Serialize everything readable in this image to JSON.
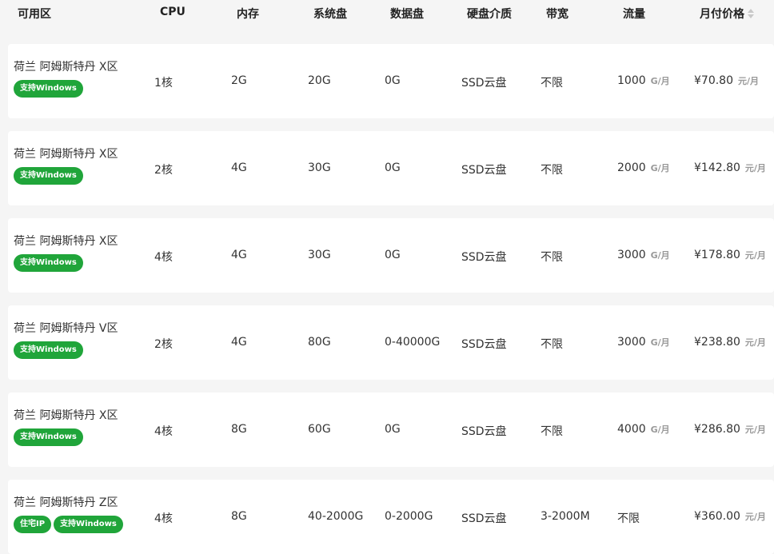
{
  "header": {
    "zone": "可用区",
    "cpu": "CPU",
    "memory": "内存",
    "system_disk": "系统盘",
    "data_disk": "数据盘",
    "disk_media": "硬盘介质",
    "bandwidth": "带宽",
    "traffic": "流量",
    "price": "月付价格"
  },
  "rows": [
    {
      "zone": "荷兰 阿姆斯特丹 X区",
      "tags": [
        "支持Windows"
      ],
      "cpu": "1核",
      "memory": "2G",
      "system_disk": "20G",
      "data_disk": "0G",
      "media": "SSD云盘",
      "bandwidth": "不限",
      "traffic": "1000",
      "traffic_unit": "G/月",
      "price": "¥70.80",
      "price_unit": "元/月"
    },
    {
      "zone": "荷兰 阿姆斯特丹 X区",
      "tags": [
        "支持Windows"
      ],
      "cpu": "2核",
      "memory": "4G",
      "system_disk": "30G",
      "data_disk": "0G",
      "media": "SSD云盘",
      "bandwidth": "不限",
      "traffic": "2000",
      "traffic_unit": "G/月",
      "price": "¥142.80",
      "price_unit": "元/月"
    },
    {
      "zone": "荷兰 阿姆斯特丹 X区",
      "tags": [
        "支持Windows"
      ],
      "cpu": "4核",
      "memory": "4G",
      "system_disk": "30G",
      "data_disk": "0G",
      "media": "SSD云盘",
      "bandwidth": "不限",
      "traffic": "3000",
      "traffic_unit": "G/月",
      "price": "¥178.80",
      "price_unit": "元/月"
    },
    {
      "zone": "荷兰 阿姆斯特丹 V区",
      "tags": [
        "支持Windows"
      ],
      "cpu": "2核",
      "memory": "4G",
      "system_disk": "80G",
      "data_disk": "0-40000G",
      "media": "SSD云盘",
      "bandwidth": "不限",
      "traffic": "3000",
      "traffic_unit": "G/月",
      "price": "¥238.80",
      "price_unit": "元/月"
    },
    {
      "zone": "荷兰 阿姆斯特丹 X区",
      "tags": [
        "支持Windows"
      ],
      "cpu": "4核",
      "memory": "8G",
      "system_disk": "60G",
      "data_disk": "0G",
      "media": "SSD云盘",
      "bandwidth": "不限",
      "traffic": "4000",
      "traffic_unit": "G/月",
      "price": "¥286.80",
      "price_unit": "元/月"
    },
    {
      "zone": "荷兰 阿姆斯特丹 Z区",
      "tags": [
        "住宅IP",
        "支持Windows"
      ],
      "cpu": "4核",
      "memory": "8G",
      "system_disk": "40-2000G",
      "data_disk": "0-2000G",
      "media": "SSD云盘",
      "bandwidth": "3-2000M",
      "traffic": "不限",
      "traffic_unit": "",
      "price": "¥360.00",
      "price_unit": "元/月"
    }
  ],
  "colors": {
    "tag_green": "#20a53a",
    "page_background": "#f5f5f5",
    "row_background": "#ffffff"
  },
  "icons": {
    "price_sort": "sort-icon"
  }
}
